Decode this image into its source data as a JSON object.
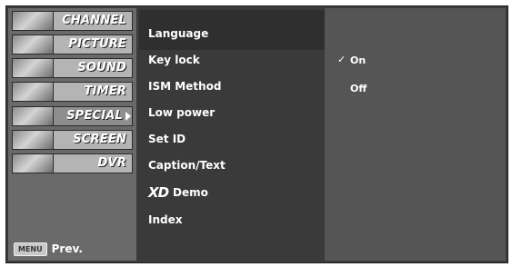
{
  "categories": [
    {
      "label": "CHANNEL",
      "icon": "channel-icon"
    },
    {
      "label": "PICTURE",
      "icon": "picture-icon"
    },
    {
      "label": "SOUND",
      "icon": "sound-icon"
    },
    {
      "label": "TIMER",
      "icon": "timer-icon"
    },
    {
      "label": "SPECIAL",
      "icon": "special-icon",
      "selected": true
    },
    {
      "label": "SCREEN",
      "icon": "screen-icon"
    },
    {
      "label": "DVR",
      "icon": "dvr-icon"
    }
  ],
  "footer": {
    "menu_key": "MENU",
    "prev_label": "Prev."
  },
  "submenu": {
    "items": [
      "Language",
      "Key lock",
      "ISM Method",
      "Low power",
      "Set ID",
      "Caption/Text",
      "Demo",
      "Index"
    ],
    "xd_logo": "XD",
    "highlighted": "Key lock"
  },
  "options": {
    "items": [
      "On",
      "Off"
    ],
    "selected": "On",
    "check_mark": "✓"
  }
}
